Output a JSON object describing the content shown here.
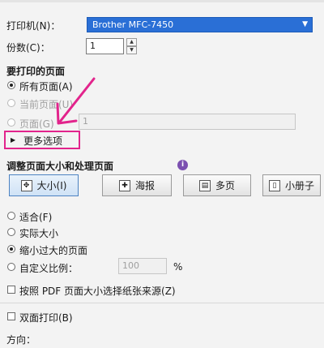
{
  "printer": {
    "label": "打印机(N)：",
    "selected": "Brother MFC-7450"
  },
  "copies": {
    "label": "份数(C)：",
    "value": "1"
  },
  "pages_section": {
    "title": "要打印的页面",
    "all_pages": "所有页面(A)",
    "current_page": "当前页面(U)",
    "pages": "页面(G)",
    "pages_value": "1",
    "more_options": "更多选项"
  },
  "sizing_section": {
    "title": "调整页面大小和处理页面",
    "info_glyph": "i",
    "modes": [
      "大小(I)",
      "海报",
      "多页",
      "小册子"
    ],
    "fit": "适合(F)",
    "actual_size": "实际大小",
    "shrink": "缩小过大的页面",
    "custom_scale": "自定义比例：",
    "scale_value": "100",
    "percent": "%",
    "choose_paper": "按照 PDF 页面大小选择纸张来源(Z)"
  },
  "duplex": {
    "label": "双面打印(B)"
  },
  "orientation": {
    "label": "方向："
  },
  "accent_color": "#e2248c"
}
